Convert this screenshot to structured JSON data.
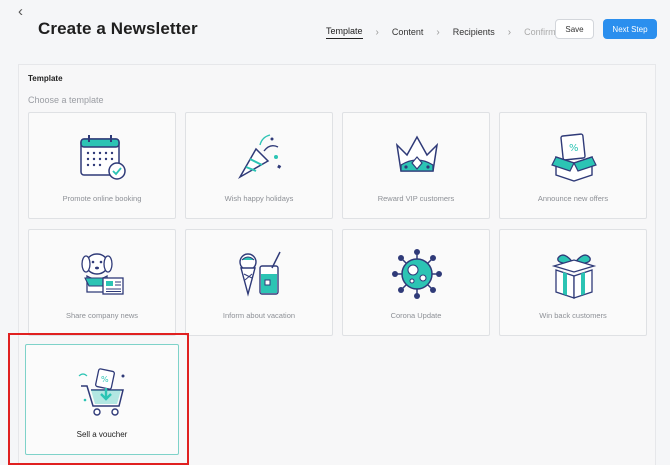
{
  "header": {
    "back_icon": "chevron-left-icon",
    "title": "Create a Newsletter",
    "steps": [
      {
        "label": "Template",
        "state": "active"
      },
      {
        "label": "Content",
        "state": "normal"
      },
      {
        "label": "Recipients",
        "state": "normal"
      },
      {
        "label": "Confirm",
        "state": "disabled"
      }
    ],
    "save_label": "Save",
    "next_label": "Next Step"
  },
  "panel": {
    "title": "Template",
    "subtitle": "Choose a template"
  },
  "templates": [
    {
      "label": "Promote online booking",
      "icon": "calendar-icon"
    },
    {
      "label": "Wish happy holidays",
      "icon": "party-popper-icon"
    },
    {
      "label": "Reward VIP customers",
      "icon": "crown-icon"
    },
    {
      "label": "Announce new offers",
      "icon": "discount-box-icon"
    },
    {
      "label": "Share company news",
      "icon": "dog-newspaper-icon"
    },
    {
      "label": "Inform about vacation",
      "icon": "ice-cream-drink-icon"
    },
    {
      "label": "Corona Update",
      "icon": "virus-icon"
    },
    {
      "label": "Win back customers",
      "icon": "gift-icon"
    },
    {
      "label": "Sell a voucher",
      "icon": "voucher-cart-icon",
      "selected": true
    }
  ],
  "colors": {
    "accent": "#2b8fee",
    "illustration_teal": "#2cc4b4",
    "illustration_navy": "#2f3a78",
    "selected_border": "#7ed2c9",
    "highlight": "#e02020"
  }
}
